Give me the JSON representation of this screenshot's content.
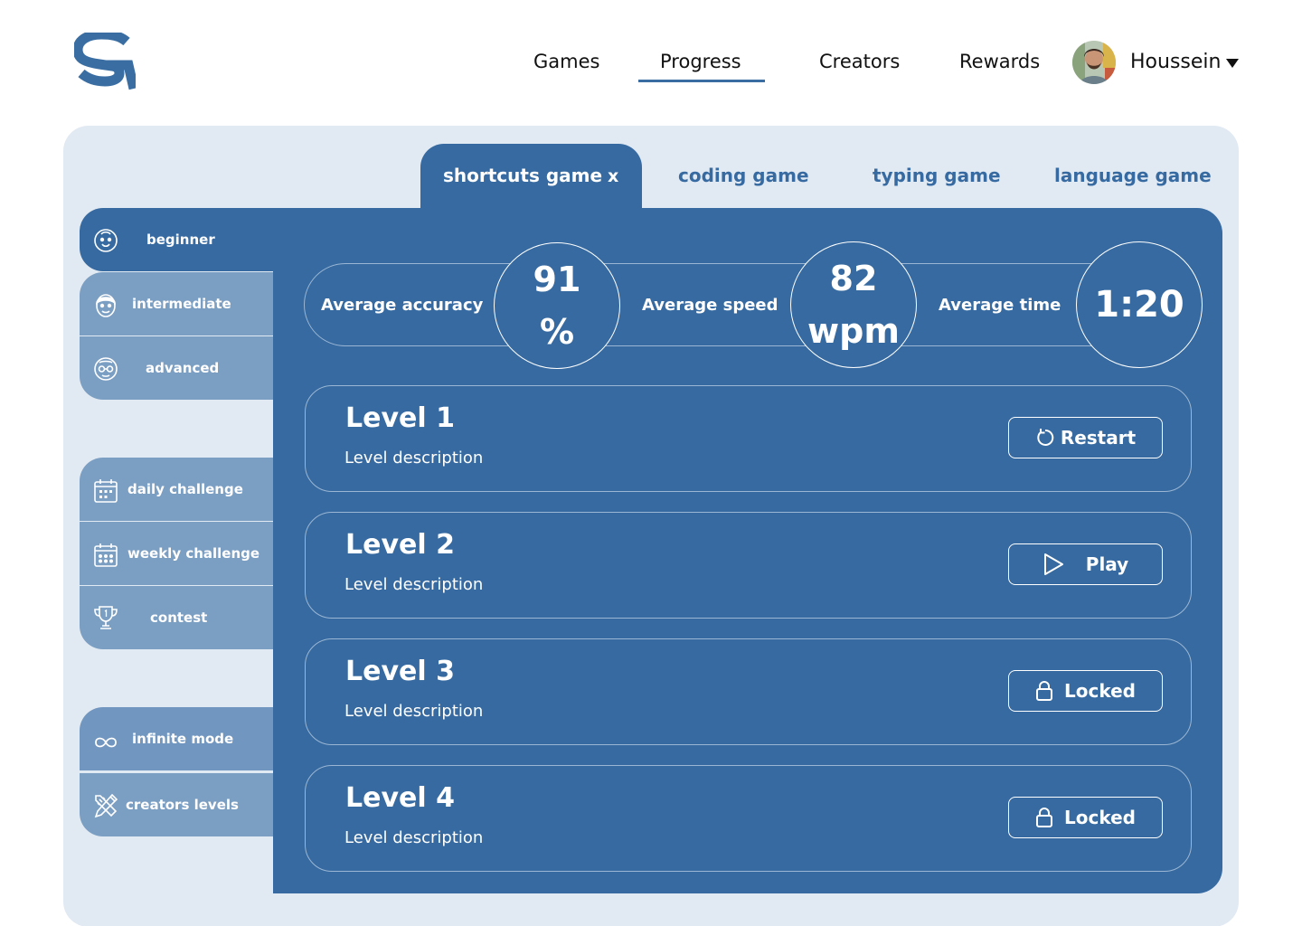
{
  "nav": {
    "links": [
      "Games",
      "Progress",
      "Creators",
      "Rewards"
    ],
    "active": "Progress",
    "user": {
      "name": "Houssein"
    }
  },
  "tabs": {
    "active": "shortcuts game",
    "close": "x",
    "others": [
      "coding game",
      "typing game",
      "language game"
    ]
  },
  "sidebar": {
    "levels": [
      {
        "label": "beginner",
        "icon": "baby-face-icon"
      },
      {
        "label": "intermediate",
        "icon": "man-face-icon"
      },
      {
        "label": "advanced",
        "icon": "old-face-glasses-icon"
      }
    ],
    "challenges": [
      {
        "label": "daily challenge",
        "icon": "calendar-day-icon"
      },
      {
        "label": "weekly challenge",
        "icon": "calendar-week-icon"
      },
      {
        "label": "contest",
        "icon": "trophy-icon"
      }
    ],
    "modes": [
      {
        "label": "infinite mode",
        "icon": "infinity-icon"
      },
      {
        "label": "creators levels",
        "icon": "design-tools-icon"
      }
    ]
  },
  "stats": {
    "accuracy": {
      "label": "Average accuracy",
      "value": "91",
      "unit": "%"
    },
    "speed": {
      "label": "Average speed",
      "value": "82",
      "unit": "wpm"
    },
    "time": {
      "label": "Average time",
      "value": "1:20"
    }
  },
  "levels": [
    {
      "title": "Level 1",
      "description": "Level description",
      "action": "Restart",
      "icon": "restart-icon"
    },
    {
      "title": "Level 2",
      "description": "Level description",
      "action": "Play",
      "icon": "play-icon"
    },
    {
      "title": "Level 3",
      "description": "Level description",
      "action": "Locked",
      "icon": "lock-icon"
    },
    {
      "title": "Level 4",
      "description": "Level description",
      "action": "Locked",
      "icon": "lock-icon"
    }
  ],
  "colors": {
    "primary": "#366aa0",
    "sidebar_inactive": "#7b9ec3",
    "background_panel": "#e1e9f3"
  }
}
